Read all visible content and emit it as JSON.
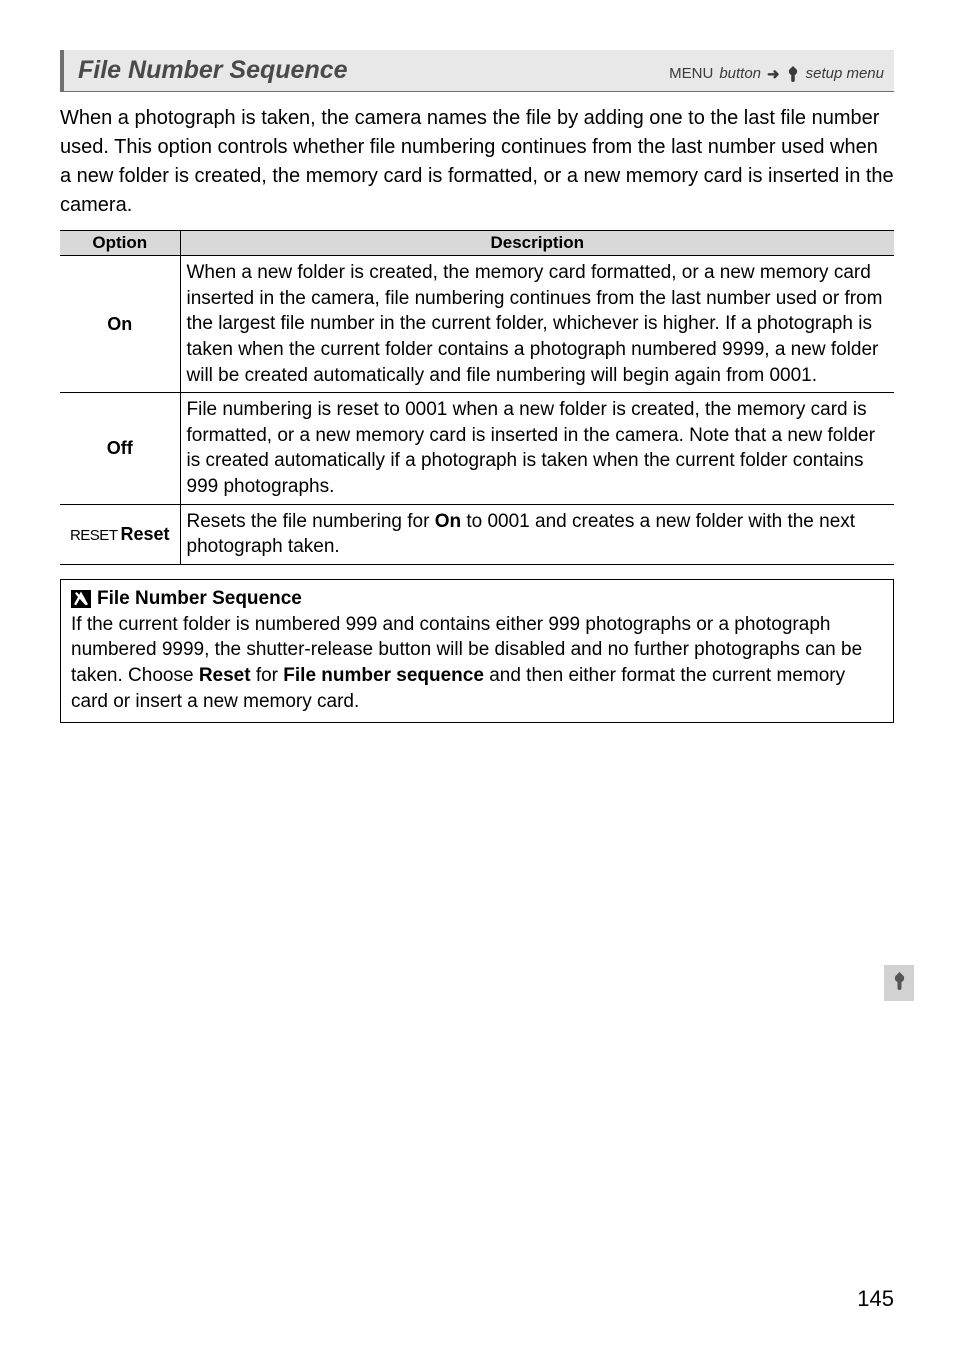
{
  "heading": {
    "title": "File Number Sequence",
    "menu_label": "MENU",
    "button_label": "button",
    "arrow": "➜",
    "setup_label": "setup menu"
  },
  "intro": "When a photograph is taken, the camera names the file by adding one to the last file number used.  This option controls whether file numbering continues from the last number used when a new folder is created, the memory card is formatted, or a new memory card is inserted in the camera.",
  "table": {
    "headers": {
      "option": "Option",
      "description": "Description"
    },
    "rows": [
      {
        "name": "On",
        "desc": "When a new folder is created, the memory card formatted, or a new memory card inserted in the camera, file numbering continues from the last number used or from the largest file number in the current folder, whichever is higher.  If a photograph is taken when the current folder contains a photograph numbered 9999, a new folder will be created automatically and file numbering will begin again from 0001."
      },
      {
        "name": "Off",
        "desc": "File numbering is reset to 0001 when a new folder is created, the memory card is formatted, or a new memory card is inserted in the camera.  Note that a new folder is created automatically if a photograph is taken when the current folder contains 999 photographs."
      },
      {
        "name_prefix": "RESET",
        "name": "Reset",
        "desc_pre": "Resets the file numbering for ",
        "desc_bold": "On",
        "desc_post": " to 0001 and creates a new folder with the next photograph taken."
      }
    ]
  },
  "note": {
    "title": "File Number Sequence",
    "body_p1": "If the current folder is numbered 999 and contains either 999 photographs or a photograph numbered 9999, the shutter-release button will be disabled and no further photographs can be taken.  Choose ",
    "body_b1": "Reset",
    "body_p2": " for ",
    "body_b2": "File number sequence",
    "body_p3": " and then either format the current memory card or insert a new memory card."
  },
  "page_number": "145"
}
